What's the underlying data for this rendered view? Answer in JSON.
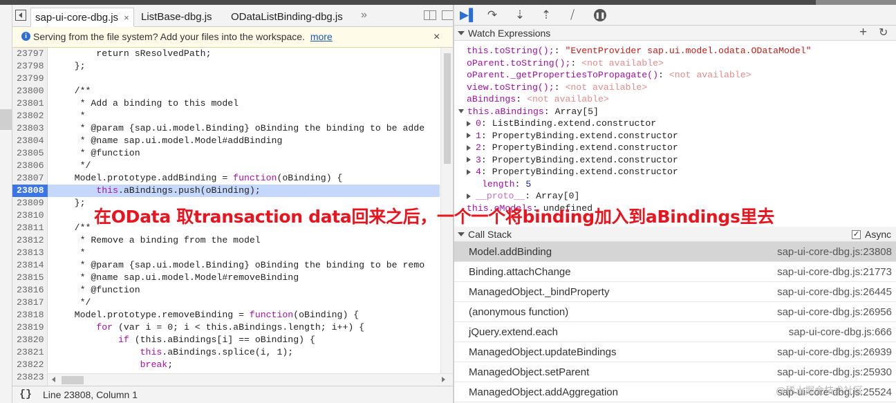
{
  "sources": {
    "tabs": [
      {
        "label": "sap-ui-core-dbg.js",
        "active": true,
        "close": "×"
      },
      {
        "label": "ListBase-dbg.js",
        "active": false
      },
      {
        "label": "ODataListBinding-dbg.js",
        "active": false
      }
    ],
    "overflow": "»",
    "infobar": {
      "message": "Serving from the file system? Add your files into the workspace.",
      "link": "more",
      "close": "×"
    },
    "code_lines": [
      {
        "n": "23797",
        "text": "        return sResolvedPath;",
        "type": "plain"
      },
      {
        "n": "23798",
        "text": "    };",
        "type": "plain"
      },
      {
        "n": "23799",
        "text": "",
        "type": "plain"
      },
      {
        "n": "23800",
        "text": "    /**",
        "type": "comment"
      },
      {
        "n": "23801",
        "text": "     * Add a binding to this model",
        "type": "comment"
      },
      {
        "n": "23802",
        "text": "     *",
        "type": "comment"
      },
      {
        "n": "23803",
        "text": "     * @param {sap.ui.model.Binding} oBinding the binding to be adde",
        "type": "comment"
      },
      {
        "n": "23804",
        "text": "     * @name sap.ui.model.Model#addBinding",
        "type": "comment"
      },
      {
        "n": "23805",
        "text": "     * @function",
        "type": "comment"
      },
      {
        "n": "23806",
        "text": "     */",
        "type": "comment"
      },
      {
        "n": "23807",
        "pre": "    Model.prototype.addBinding = ",
        "kw": "function",
        "post": "(oBinding) {",
        "type": "kw"
      },
      {
        "n": "23808",
        "pre": "        ",
        "kw": "this",
        "post": ".aBindings.push(oBinding);",
        "type": "kw",
        "active": true
      },
      {
        "n": "23809",
        "text": "    };",
        "type": "plain"
      },
      {
        "n": "23810",
        "text": "",
        "type": "plain"
      },
      {
        "n": "23811",
        "text": "    /**",
        "type": "comment"
      },
      {
        "n": "23812",
        "text": "     * Remove a binding from the model",
        "type": "comment"
      },
      {
        "n": "23813",
        "text": "     *",
        "type": "comment"
      },
      {
        "n": "23814",
        "text": "     * @param {sap.ui.model.Binding} oBinding the binding to be remo",
        "type": "comment"
      },
      {
        "n": "23815",
        "text": "     * @name sap.ui.model.Model#removeBinding",
        "type": "comment"
      },
      {
        "n": "23816",
        "text": "     * @function",
        "type": "comment"
      },
      {
        "n": "23817",
        "text": "     */",
        "type": "comment"
      },
      {
        "n": "23818",
        "pre": "    Model.prototype.removeBinding = ",
        "kw": "function",
        "post": "(oBinding) {",
        "type": "kw"
      },
      {
        "n": "23819",
        "pre": "        ",
        "kw": "for",
        "post": " (var i = 0; i < this.aBindings.length; i++) {",
        "type": "kw"
      },
      {
        "n": "23820",
        "pre": "            ",
        "kw": "if",
        "post": " (this.aBindings[i] == oBinding) {",
        "type": "kw"
      },
      {
        "n": "23821",
        "pre": "                ",
        "kw": "this",
        "post": ".aBindings.splice(i, 1);",
        "type": "kw"
      },
      {
        "n": "23822",
        "pre": "                ",
        "kw": "break",
        "post": ";",
        "type": "kw"
      },
      {
        "n": "23823",
        "text": "",
        "type": "plain"
      }
    ],
    "status": {
      "braces": "{}",
      "position": "Line 23808, Column 1"
    }
  },
  "debugger": {
    "toolbar_icons": [
      "resume-icon",
      "step-over-icon",
      "step-into-icon",
      "step-out-icon",
      "deactivate-breakpoints-icon",
      "pause-on-exceptions-icon"
    ],
    "watch": {
      "title": "Watch Expressions",
      "add": "+",
      "refresh": "↻",
      "rows": [
        {
          "name": "this.toString();",
          "value": "\"EventProvider sap.ui.model.odata.ODataModel\"",
          "vtype": "string",
          "indent": 0
        },
        {
          "name": "oParent.toString();",
          "value": "<not available>",
          "vtype": "na",
          "indent": 0
        },
        {
          "name": "oParent._getPropertiesToPropagate()",
          "value": "<not available>",
          "vtype": "na",
          "indent": 0
        },
        {
          "name": "view.toString();",
          "value": "<not available>",
          "vtype": "na",
          "indent": 0
        },
        {
          "name": "aBindings",
          "value": "<not available>",
          "vtype": "na",
          "indent": 0
        },
        {
          "name": "this.aBindings",
          "value": "Array[5]",
          "vtype": "plain",
          "indent": 0,
          "toggle": "open"
        },
        {
          "name": "0",
          "value": "ListBinding.extend.constructor",
          "vtype": "plain",
          "indent": 1,
          "toggle": "closed"
        },
        {
          "name": "1",
          "value": "PropertyBinding.extend.constructor",
          "vtype": "plain",
          "indent": 1,
          "toggle": "closed"
        },
        {
          "name": "2",
          "value": "PropertyBinding.extend.constructor",
          "vtype": "plain",
          "indent": 1,
          "toggle": "closed"
        },
        {
          "name": "3",
          "value": "PropertyBinding.extend.constructor",
          "vtype": "plain",
          "indent": 1,
          "toggle": "closed"
        },
        {
          "name": "4",
          "value": "PropertyBinding.extend.constructor",
          "vtype": "plain",
          "indent": 1,
          "toggle": "closed"
        },
        {
          "name": "length",
          "value": "5",
          "vtype": "number",
          "indent": 1
        },
        {
          "name": "__proto__",
          "value": "Array[0]",
          "vtype": "plain",
          "indent": 1,
          "toggle": "closed"
        },
        {
          "name": "this.oModels",
          "value": "undefined",
          "vtype": "plain",
          "indent": 0
        }
      ]
    },
    "callstack": {
      "title": "Call Stack",
      "async_label": "Async",
      "async_checked": "✓",
      "frames": [
        {
          "fn": "Model.addBinding",
          "loc": "sap-ui-core-dbg.js:23808",
          "selected": true
        },
        {
          "fn": "Binding.attachChange",
          "loc": "sap-ui-core-dbg.js:21773"
        },
        {
          "fn": "ManagedObject._bindProperty",
          "loc": "sap-ui-core-dbg.js:26445"
        },
        {
          "fn": "(anonymous function)",
          "loc": "sap-ui-core-dbg.js:26956"
        },
        {
          "fn": "jQuery.extend.each",
          "loc": "sap-ui-core-dbg.js:666"
        },
        {
          "fn": "ManagedObject.updateBindings",
          "loc": "sap-ui-core-dbg.js:26939"
        },
        {
          "fn": "ManagedObject.setParent",
          "loc": "sap-ui-core-dbg.js:25930"
        },
        {
          "fn": "ManagedObject.addAggregation",
          "loc": "sap-ui-core-dbg.js:25524"
        }
      ]
    }
  },
  "annotation": "在OData 取transaction data回来之后，一个一个将binding加入到aBindings里去",
  "watermark": "@稀土掘金技术社区"
}
